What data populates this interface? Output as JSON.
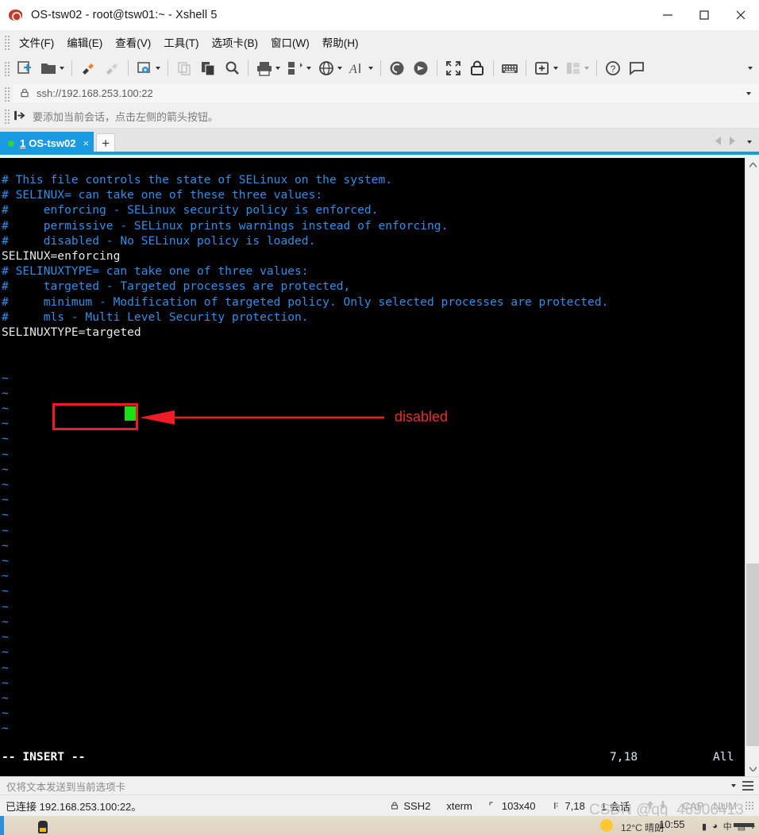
{
  "window": {
    "title": "OS-tsw02 - root@tsw01:~ - Xshell 5",
    "app_icon": "xshell-snail-icon",
    "controls": {
      "minimize": "minimize-icon",
      "maximize": "maximize-icon",
      "close": "close-icon"
    }
  },
  "menu": {
    "items": [
      {
        "label": "文件(F)",
        "name": "menu-file"
      },
      {
        "label": "编辑(E)",
        "name": "menu-edit"
      },
      {
        "label": "查看(V)",
        "name": "menu-view"
      },
      {
        "label": "工具(T)",
        "name": "menu-tools"
      },
      {
        "label": "选项卡(B)",
        "name": "menu-tab"
      },
      {
        "label": "窗口(W)",
        "name": "menu-window"
      },
      {
        "label": "帮助(H)",
        "name": "menu-help"
      }
    ]
  },
  "toolbar": {
    "items": [
      {
        "icon": "new-session-icon",
        "caret": false
      },
      {
        "icon": "open-folder-icon",
        "caret": true
      },
      {
        "icon": "connect-icon",
        "caret": false
      },
      {
        "icon": "disconnect-icon",
        "caret": false
      },
      {
        "icon": "session-properties-icon",
        "caret": true
      },
      {
        "icon": "copy-page-icon",
        "caret": false
      },
      {
        "icon": "paste-icon",
        "caret": false
      },
      {
        "icon": "find-icon",
        "caret": false
      },
      {
        "icon": "print-icon",
        "caret": true
      },
      {
        "icon": "file-transfer-icon",
        "caret": true
      },
      {
        "icon": "globe-icon",
        "caret": true
      },
      {
        "icon": "font-icon",
        "caret": true
      },
      {
        "icon": "ftp-icon",
        "caret": false
      },
      {
        "icon": "sftp-icon",
        "caret": false
      },
      {
        "icon": "fullscreen-icon",
        "caret": false
      },
      {
        "icon": "lock-icon",
        "caret": false
      },
      {
        "icon": "keyboard-icon",
        "caret": false
      },
      {
        "icon": "add-folder-icon",
        "caret": true
      },
      {
        "icon": "layout-icon",
        "caret": true
      },
      {
        "icon": "help-icon",
        "caret": false
      },
      {
        "icon": "feedback-icon",
        "caret": false
      }
    ],
    "overflow_icon": "toolbar-overflow-caret"
  },
  "address_bar": {
    "lock_icon": "lock-icon",
    "value": "ssh://192.168.253.100:22",
    "dropdown_icon": "chevron-down-icon"
  },
  "notice_bar": {
    "icon": "arrow-to-bar-icon",
    "text": "要添加当前会话，点击左侧的箭头按钮。"
  },
  "tabs": {
    "active": {
      "number": "1",
      "label": "OS-tsw02",
      "close_label": "×",
      "status_dot": "connected-green-dot"
    },
    "new_tab_label": "+",
    "nav": {
      "prev_icon": "chevron-left-icon",
      "next_icon": "chevron-right-icon",
      "list_icon": "chevron-down-icon"
    }
  },
  "terminal": {
    "lines": [
      {
        "text": "# This file controls the state of SELinux on the system.",
        "style": "comment"
      },
      {
        "text": "# SELINUX= can take one of these three values:",
        "style": "comment"
      },
      {
        "text": "#     enforcing - SELinux security policy is enforced.",
        "style": "comment"
      },
      {
        "text": "#     permissive - SELinux prints warnings instead of enforcing.",
        "style": "comment"
      },
      {
        "text": "#     disabled - No SELinux policy is loaded.",
        "style": "comment"
      },
      {
        "text": "SELINUX=enforcing",
        "style": "plain"
      },
      {
        "text": "# SELINUXTYPE= can take one of three values:",
        "style": "comment"
      },
      {
        "text": "#     targeted - Targeted processes are protected,",
        "style": "comment"
      },
      {
        "text": "#     minimum - Modification of targeted policy. Only selected processes are protected.",
        "style": "comment"
      },
      {
        "text": "#     mls - Multi Level Security protection.",
        "style": "comment"
      },
      {
        "text": "SELINUXTYPE=targeted",
        "style": "plain"
      },
      {
        "text": "",
        "style": "plain"
      },
      {
        "text": "",
        "style": "plain"
      },
      {
        "text": "~",
        "style": "tilde"
      },
      {
        "text": "~",
        "style": "tilde"
      },
      {
        "text": "~",
        "style": "tilde"
      },
      {
        "text": "~",
        "style": "tilde"
      },
      {
        "text": "~",
        "style": "tilde"
      },
      {
        "text": "~",
        "style": "tilde"
      },
      {
        "text": "~",
        "style": "tilde"
      },
      {
        "text": "~",
        "style": "tilde"
      },
      {
        "text": "~",
        "style": "tilde"
      },
      {
        "text": "~",
        "style": "tilde"
      },
      {
        "text": "~",
        "style": "tilde"
      },
      {
        "text": "~",
        "style": "tilde"
      },
      {
        "text": "~",
        "style": "tilde"
      },
      {
        "text": "~",
        "style": "tilde"
      },
      {
        "text": "~",
        "style": "tilde"
      },
      {
        "text": "~",
        "style": "tilde"
      },
      {
        "text": "~",
        "style": "tilde"
      },
      {
        "text": "~",
        "style": "tilde"
      },
      {
        "text": "~",
        "style": "tilde"
      },
      {
        "text": "~",
        "style": "tilde"
      },
      {
        "text": "~",
        "style": "tilde"
      },
      {
        "text": "~",
        "style": "tilde"
      },
      {
        "text": "~",
        "style": "tilde"
      },
      {
        "text": "~",
        "style": "tilde"
      }
    ],
    "vim_status": {
      "mode": "-- INSERT --",
      "position": "7,18",
      "scroll": "All"
    },
    "cursor": {
      "type": "block",
      "color": "#16e016"
    },
    "colors": {
      "background": "#000000",
      "comment": "#2f8fe8",
      "text": "#e8e8e8"
    },
    "scrollbar": {
      "up_icon": "chevron-up-icon",
      "down_icon": "chevron-down-icon"
    }
  },
  "annotation": {
    "box_color": "#ee1c25",
    "arrow_color": "#ee1c25",
    "label": "disabled",
    "label_color": "#e8302a"
  },
  "send_bar": {
    "text": "仅将文本发送到当前选项卡",
    "dropdown_icon": "chevron-down-icon",
    "menu_icon": "hamburger-icon"
  },
  "status_bar": {
    "connection": "已连接 192.168.253.100:22。",
    "cells": [
      {
        "icon": "lock-icon",
        "label": "SSH2",
        "dim": false
      },
      {
        "icon": "",
        "label": "xterm",
        "dim": false
      },
      {
        "icon": "size-icon",
        "label": "103x40",
        "dim": false
      },
      {
        "icon": "cursor-icon",
        "label": "7,18",
        "dim": false
      },
      {
        "icon": "",
        "label": "1 会话",
        "dim": false
      }
    ],
    "transfer_up_icon": "arrow-up-icon",
    "transfer_down_icon": "arrow-down-icon",
    "caps": "CAP",
    "num": "NUM"
  },
  "watermark": {
    "text": "CSDN @qq_46906413"
  },
  "taskbar": {
    "weather": "12°C 晴朗",
    "clock": "10:55"
  }
}
